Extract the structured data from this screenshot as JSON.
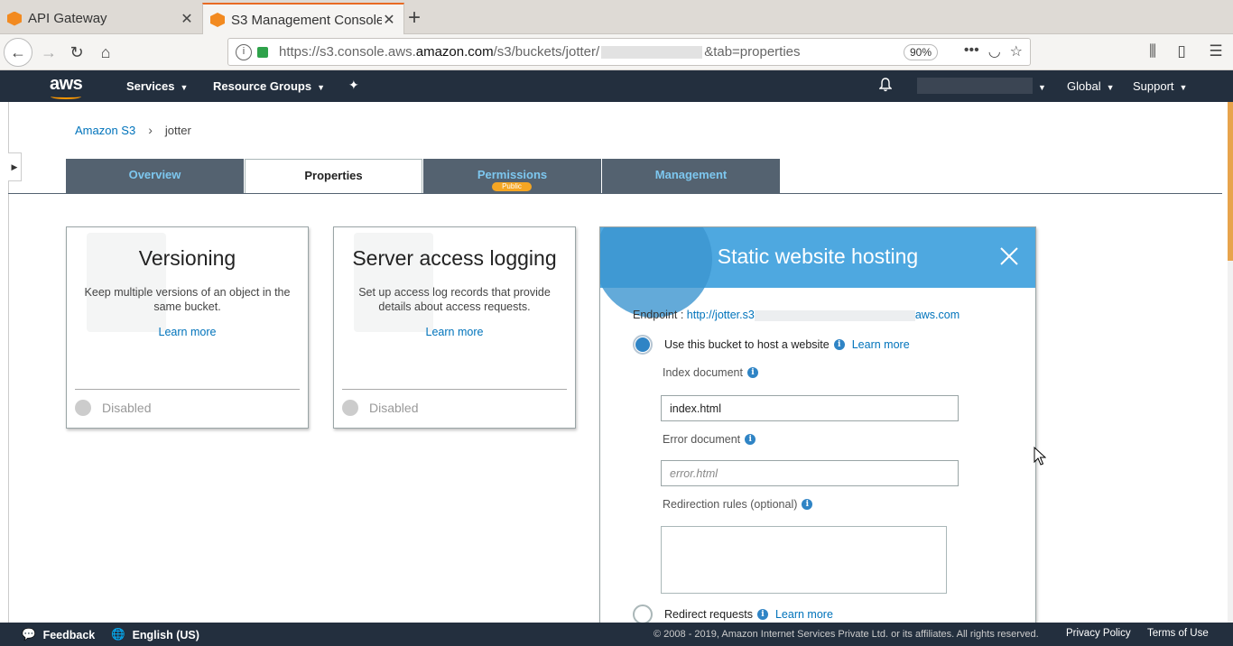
{
  "browser": {
    "tabs": [
      {
        "label": "API Gateway",
        "active": false
      },
      {
        "label": "S3 Management Console",
        "active": true
      }
    ],
    "url": {
      "prefix": "https://s3.console.aws.",
      "domain": "amazon.com",
      "path": "/s3/buckets/jotter/",
      "suffix": "&tab=properties"
    },
    "zoom": "90%"
  },
  "aws_header": {
    "logo": "aws",
    "services": "Services",
    "resource_groups": "Resource Groups",
    "region": "Global",
    "support": "Support"
  },
  "breadcrumb": {
    "root": "Amazon S3",
    "current": "jotter"
  },
  "tabs": {
    "overview": "Overview",
    "properties": "Properties",
    "permissions": "Permissions",
    "permissions_badge": "Public",
    "management": "Management"
  },
  "cards": {
    "versioning": {
      "title": "Versioning",
      "description": "Keep multiple versions of an object in the same bucket.",
      "learn_more": "Learn more",
      "status": "Disabled"
    },
    "logging": {
      "title": "Server access logging",
      "description": "Set up access log records that provide details about access requests.",
      "learn_more": "Learn more",
      "status": "Disabled"
    }
  },
  "static_hosting": {
    "title": "Static website hosting",
    "endpoint_label": "Endpoint :",
    "endpoint_start": "http://jotter.s3",
    "endpoint_end": "aws.com",
    "use_bucket": "Use this bucket to host a website",
    "learn_more": "Learn more",
    "index_label": "Index document",
    "index_value": "index.html",
    "error_label": "Error document",
    "error_placeholder": "error.html",
    "redirection_label": "Redirection rules (optional)",
    "redirect_requests": "Redirect requests",
    "redirect_learn_more": "Learn more"
  },
  "footer": {
    "feedback": "Feedback",
    "language": "English (US)",
    "copyright": "© 2008 - 2019, Amazon Internet Services Private Ltd. or its affiliates. All rights reserved.",
    "privacy": "Privacy Policy",
    "terms": "Terms of Use"
  },
  "colors": {
    "aws_header": "#232f3e",
    "tab_inactive": "#546270",
    "link": "#0073bb",
    "hosting_header": "#4ea8e0",
    "accent": "#ff9900"
  }
}
